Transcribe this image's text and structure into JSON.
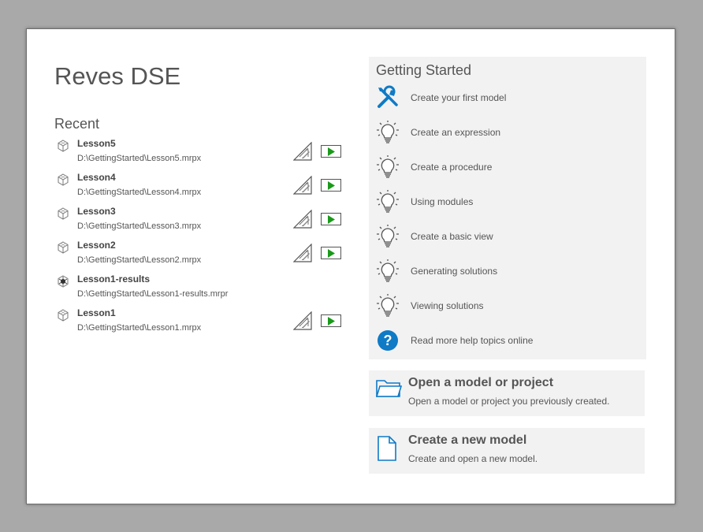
{
  "app": {
    "title": "Reves DSE"
  },
  "recent": {
    "heading": "Recent",
    "items": [
      {
        "name": "Lesson5",
        "path": "D:\\GettingStarted\\Lesson5.mrpx",
        "type": "model"
      },
      {
        "name": "Lesson4",
        "path": "D:\\GettingStarted\\Lesson4.mrpx",
        "type": "model"
      },
      {
        "name": "Lesson3",
        "path": "D:\\GettingStarted\\Lesson3.mrpx",
        "type": "model"
      },
      {
        "name": "Lesson2",
        "path": "D:\\GettingStarted\\Lesson2.mrpx",
        "type": "model"
      },
      {
        "name": "Lesson1-results",
        "path": "D:\\GettingStarted\\Lesson1-results.mrpr",
        "type": "results"
      },
      {
        "name": "Lesson1",
        "path": "D:\\GettingStarted\\Lesson1.mrpx",
        "type": "model"
      }
    ]
  },
  "getting_started": {
    "heading": "Getting Started",
    "items": [
      {
        "label": "Create your first model",
        "icon": "wrench-screwdriver-icon"
      },
      {
        "label": "Create an expression",
        "icon": "lightbulb-icon"
      },
      {
        "label": "Create a procedure",
        "icon": "lightbulb-icon"
      },
      {
        "label": "Using modules",
        "icon": "lightbulb-icon"
      },
      {
        "label": "Create a basic view",
        "icon": "lightbulb-icon"
      },
      {
        "label": "Generating solutions",
        "icon": "lightbulb-icon"
      },
      {
        "label": "Viewing solutions",
        "icon": "lightbulb-icon"
      },
      {
        "label": "Read more help topics online",
        "icon": "help-icon"
      }
    ]
  },
  "actions": {
    "open": {
      "title": "Open a model or project",
      "description": "Open a model or project you previously created.",
      "icon": "folder-icon"
    },
    "create": {
      "title": "Create a new model",
      "description": "Create and open a new model.",
      "icon": "new-document-icon"
    }
  },
  "colors": {
    "accent_blue": "#0f7ac6",
    "run_green": "#1a9a1a"
  }
}
